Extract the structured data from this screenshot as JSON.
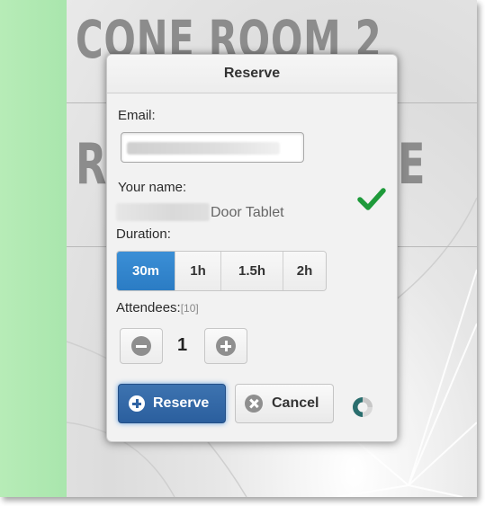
{
  "background": {
    "room_title": "CONE ROOM 2",
    "letter_left": "R",
    "letter_right": "E"
  },
  "dialog": {
    "title": "Reserve",
    "email_label": "Email:",
    "email_value": "",
    "name_label": "Your name:",
    "name_suffix": "Door Tablet",
    "duration_label": "Duration:",
    "durations": [
      {
        "label": "30m",
        "selected": true
      },
      {
        "label": "1h",
        "selected": false
      },
      {
        "label": "1.5h",
        "selected": false
      },
      {
        "label": "2h",
        "selected": false
      }
    ],
    "attendees_label": "Attendees:",
    "attendees_max": "[10]",
    "attendees_value": "1",
    "reserve_label": "Reserve",
    "cancel_label": "Cancel"
  },
  "colors": {
    "accent": "#2b7cc4",
    "primary_button": "#2f63a3",
    "check": "#1e9a3a",
    "side_strip": "#b2eab3"
  },
  "icons": [
    "check-icon",
    "minus-circle-icon",
    "plus-circle-icon",
    "plus-icon",
    "close-circle-icon",
    "spinner-icon"
  ]
}
